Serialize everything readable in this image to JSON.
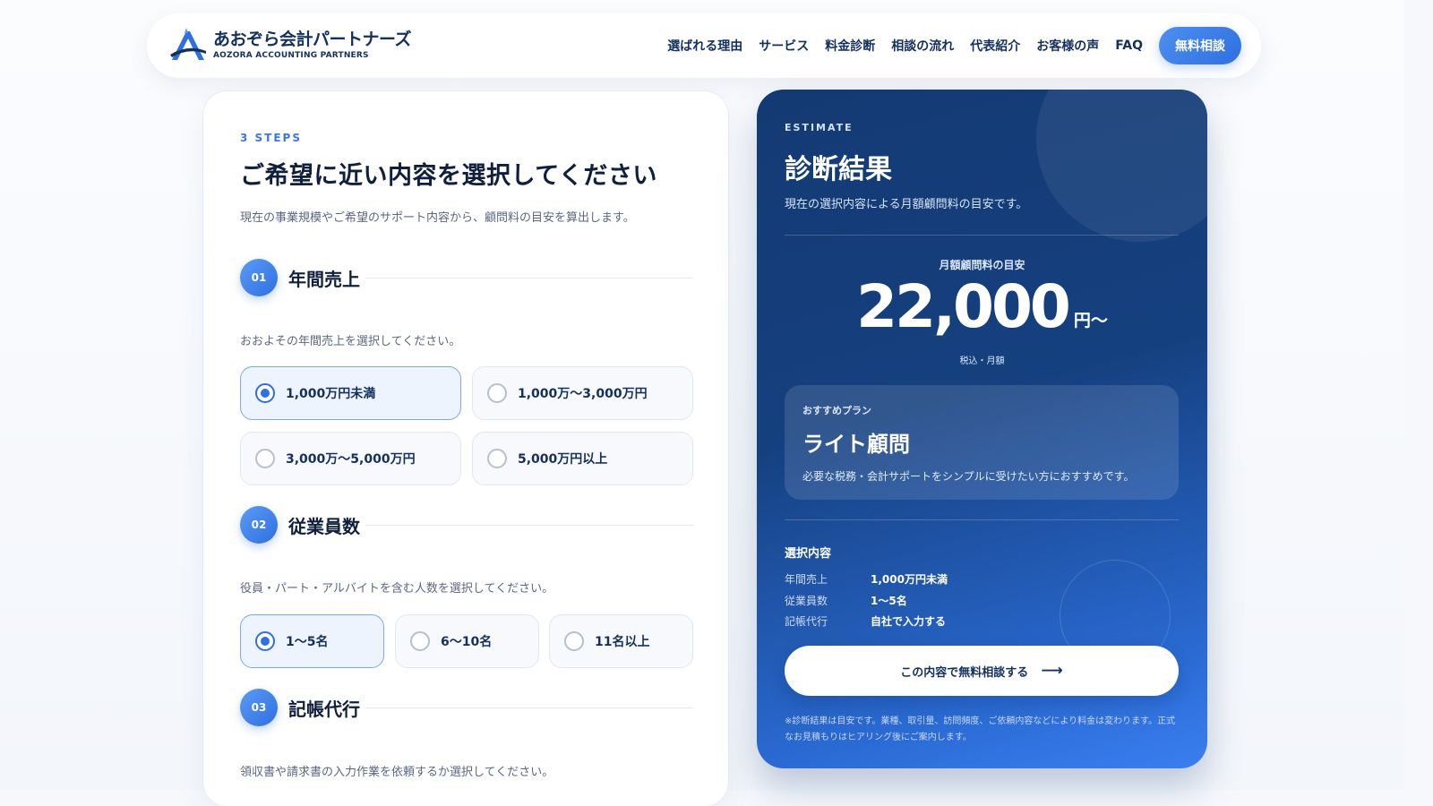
{
  "header": {
    "logo_main": "あおぞら会計パートナーズ",
    "logo_sub": "AOZORA ACCOUNTING PARTNERS",
    "nav": [
      "選ばれる理由",
      "サービス",
      "料金診断",
      "相談の流れ",
      "代表紹介",
      "お客様の声",
      "FAQ"
    ],
    "cta": "無料相談"
  },
  "form": {
    "steps_label": "3 STEPS",
    "title": "ご希望に近い内容を選択してください",
    "desc": "現在の事業規模やご希望のサポート内容から、顧問料の目安を算出します。",
    "sections": [
      {
        "num": "01",
        "title": "年間売上",
        "desc": "おおよその年間売上を選択してください。",
        "options": [
          "1,000万円未満",
          "1,000万〜3,000万円",
          "3,000万〜5,000万円",
          "5,000万円以上"
        ],
        "selected": "1,000万円未満"
      },
      {
        "num": "02",
        "title": "従業員数",
        "desc": "役員・パート・アルバイトを含む人数を選択してください。",
        "options": [
          "1〜5名",
          "6〜10名",
          "11名以上"
        ],
        "selected": "1〜5名"
      },
      {
        "num": "03",
        "title": "記帳代行",
        "desc": "領収書や請求書の入力作業を依頼するか選択してください。"
      }
    ]
  },
  "result": {
    "label": "ESTIMATE",
    "title": "診断結果",
    "sub": "現在の選択内容による月額顧問料の目安です。",
    "price_label": "月額顧問料の目安",
    "price": "22,000",
    "price_unit": "円〜",
    "price_note": "税込・月額",
    "plan_kicker": "おすすめプラン",
    "plan_name": "ライト顧問",
    "plan_desc": "必要な税務・会計サポートをシンプルに受けたい方におすすめです。",
    "selection_title": "選択内容",
    "selection": [
      {
        "key": "年間売上",
        "value": "1,000万円未満"
      },
      {
        "key": "従業員数",
        "value": "1〜5名"
      },
      {
        "key": "記帳代行",
        "value": "自社で入力する"
      }
    ],
    "button": "この内容で無料相談する",
    "button_icon": "arrow-right-icon",
    "disclaimer": "※診断結果は目安です。業種、取引量、訪問頻度、ご依頼内容などにより料金は変わります。正式なお見積もりはヒアリング後にご案内します。"
  },
  "colors": {
    "accent": "#2f6fe0",
    "navy": "#14305e",
    "card_dark": "#143a73"
  }
}
